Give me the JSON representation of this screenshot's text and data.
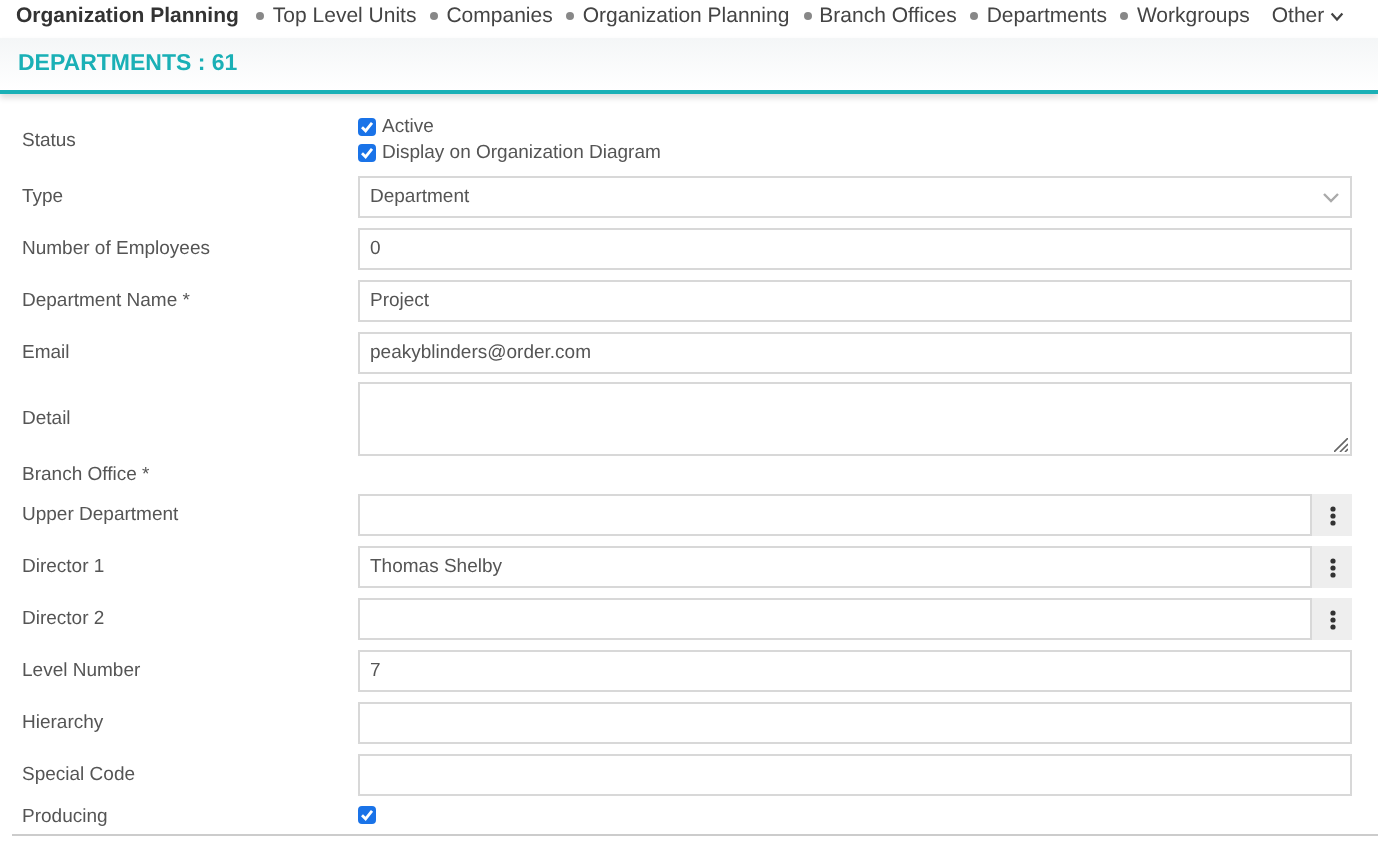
{
  "nav": {
    "title": "Organization Planning",
    "links": [
      {
        "label": "Top Level Units"
      },
      {
        "label": "Companies"
      },
      {
        "label": "Organization Planning"
      },
      {
        "label": "Branch Offices"
      },
      {
        "label": "Departments"
      },
      {
        "label": "Workgroups"
      }
    ],
    "more": "Other"
  },
  "header": {
    "title": "DEPARTMENTS : 61"
  },
  "fields": [
    {
      "kind": "checks",
      "label": "Status",
      "options": [
        {
          "label": "Active",
          "checked": true
        },
        {
          "label": "Display on Organization Diagram",
          "checked": true
        }
      ]
    },
    {
      "kind": "select",
      "label": "Type",
      "value": "Department"
    },
    {
      "kind": "text",
      "label": "Number of Employees",
      "value": "0"
    },
    {
      "kind": "text",
      "label": "Department Name *",
      "value": "Project"
    },
    {
      "kind": "text",
      "label": "Email",
      "value": "peakyblinders@order.com"
    },
    {
      "kind": "textarea",
      "label": "Detail"
    },
    {
      "kind": "label",
      "label": "Branch Office *"
    },
    {
      "kind": "lookup",
      "label": "Upper Department"
    },
    {
      "kind": "lookup",
      "label": "Director 1",
      "value": "Thomas Shelby"
    },
    {
      "kind": "lookup",
      "label": "Director 2"
    },
    {
      "kind": "text",
      "label": "Level Number",
      "value": "7"
    },
    {
      "kind": "text",
      "label": "Hierarchy"
    },
    {
      "kind": "text",
      "label": "Special Code"
    },
    {
      "kind": "check",
      "label": "Producing",
      "checked": true
    }
  ]
}
